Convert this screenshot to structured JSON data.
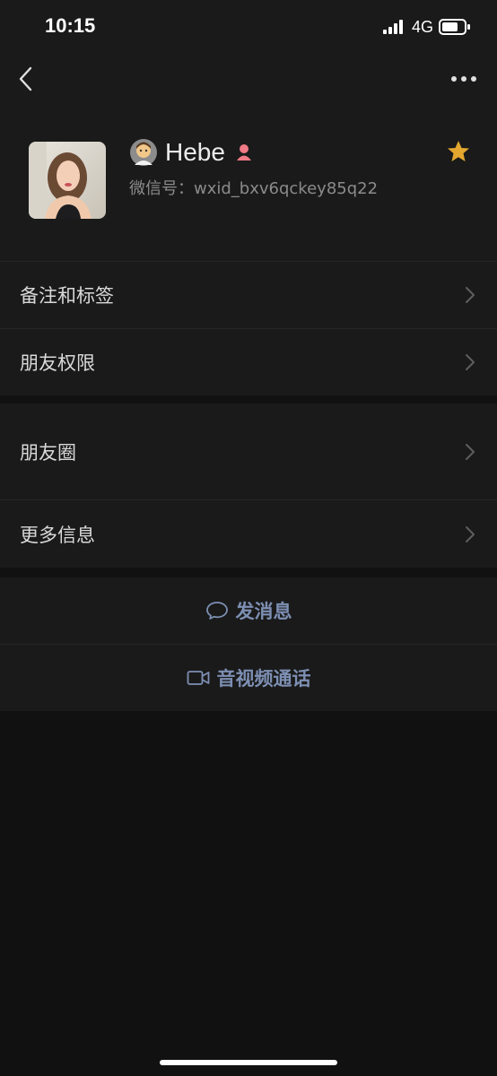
{
  "status_bar": {
    "time": "10:15",
    "network": "4G"
  },
  "nav": {
    "back_icon": "chevron-left-icon",
    "more_icon": "more-dots-icon"
  },
  "profile": {
    "name": "Hebe",
    "name_emoji": "person-emoji-icon",
    "gender_icon": "female-icon",
    "wechat_id": "微信号：wxid_bxv6qckey85q22",
    "star_icon": "star-icon",
    "star_color": "#e3a72f"
  },
  "group1": [
    {
      "label": "备注和标签"
    },
    {
      "label": "朋友权限"
    }
  ],
  "group2": [
    {
      "label": "朋友圈"
    },
    {
      "label": "更多信息"
    }
  ],
  "actions": {
    "message_label": "发消息",
    "call_label": "音视频通话",
    "accent_color": "#7d8fb3"
  }
}
